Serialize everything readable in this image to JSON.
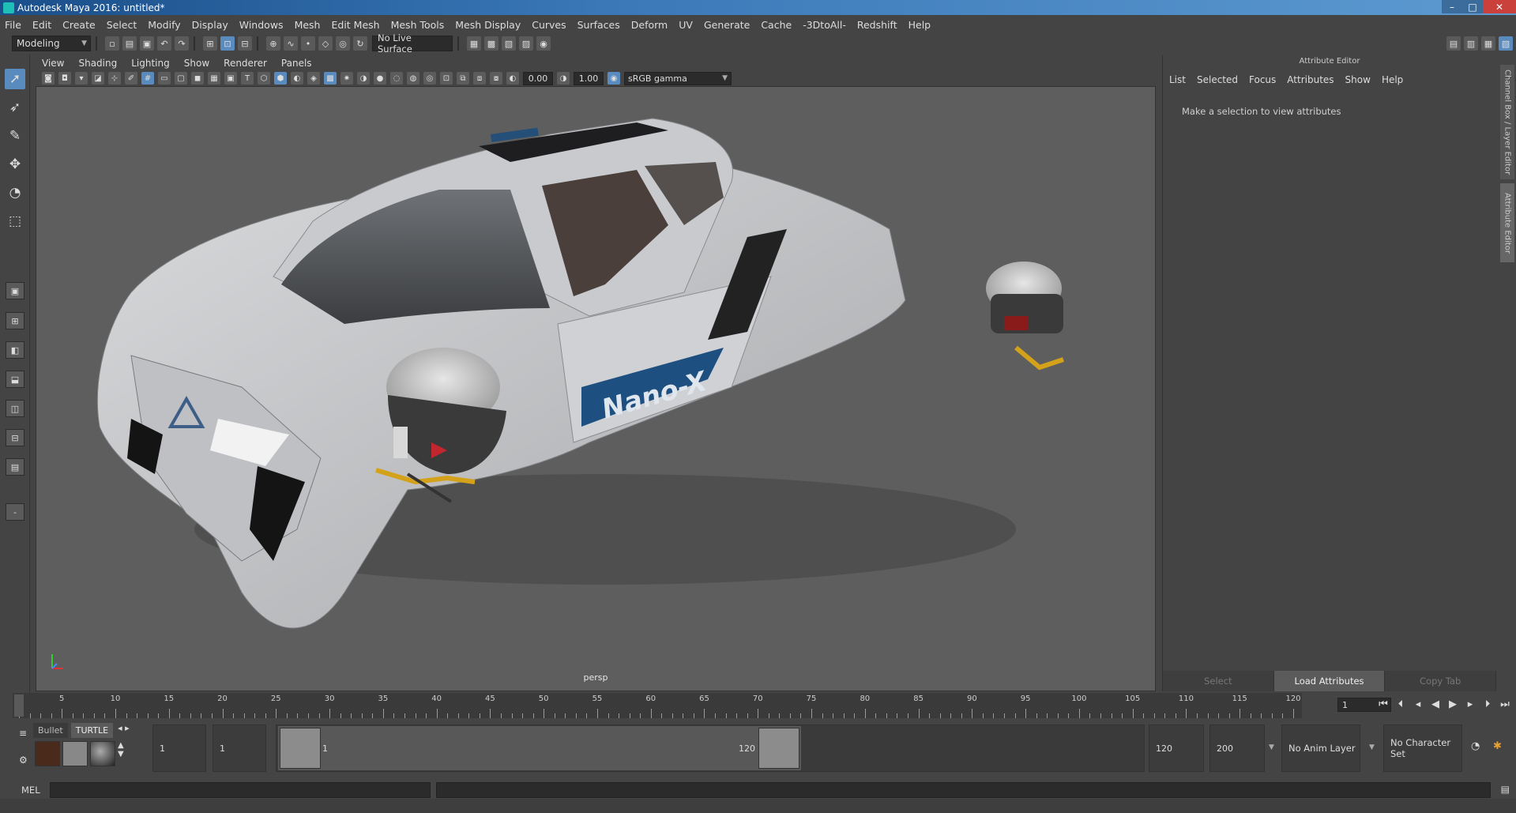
{
  "window": {
    "title": "Autodesk Maya 2016: untitled*",
    "minimize": "–",
    "maximize": "□",
    "close": "✕"
  },
  "menubar": [
    "File",
    "Edit",
    "Create",
    "Select",
    "Modify",
    "Display",
    "Windows",
    "Mesh",
    "Edit Mesh",
    "Mesh Tools",
    "Mesh Display",
    "Curves",
    "Surfaces",
    "Deform",
    "UV",
    "Generate",
    "Cache",
    "-3DtoAll-",
    "Redshift",
    "Help"
  ],
  "statusline": {
    "mode": "Modeling",
    "live_surface": "No Live Surface"
  },
  "panel": {
    "menus": [
      "View",
      "Shading",
      "Lighting",
      "Show",
      "Renderer",
      "Panels"
    ],
    "exposure": "0.00",
    "gamma": "1.00",
    "color_space": "sRGB gamma",
    "camera_label": "persp"
  },
  "viewport_model": {
    "decal_text": "Nano-X"
  },
  "attribute_editor": {
    "title": "Attribute Editor",
    "menus": [
      "List",
      "Selected",
      "Focus",
      "Attributes",
      "Show",
      "Help"
    ],
    "message": "Make a selection to view attributes",
    "buttons": {
      "select": "Select",
      "load": "Load Attributes",
      "copy": "Copy Tab"
    },
    "side_tabs": [
      "Channel Box / Layer Editor",
      "Attribute Editor"
    ]
  },
  "timeline": {
    "ticks": [
      "1",
      "5",
      "10",
      "15",
      "20",
      "25",
      "30",
      "35",
      "40",
      "45",
      "50",
      "55",
      "60",
      "65",
      "70",
      "75",
      "80",
      "85",
      "90",
      "95",
      "100",
      "105",
      "110",
      "115",
      "120"
    ],
    "current_frame": "1"
  },
  "range": {
    "shelf_tabs": [
      "Bullet",
      "TURTLE"
    ],
    "start_time": "1",
    "playback_start": "1",
    "range_start_label": "1",
    "range_end_label": "120",
    "playback_end": "120",
    "end_time": "200",
    "anim_layer": "No Anim Layer",
    "character_set": "No Character Set"
  },
  "cmdline": {
    "label": "MEL"
  },
  "colors": {
    "accent": "#5a8bbf",
    "maya_teal": "#0fa9a3",
    "viewport_bg": "#5e5e5e"
  }
}
